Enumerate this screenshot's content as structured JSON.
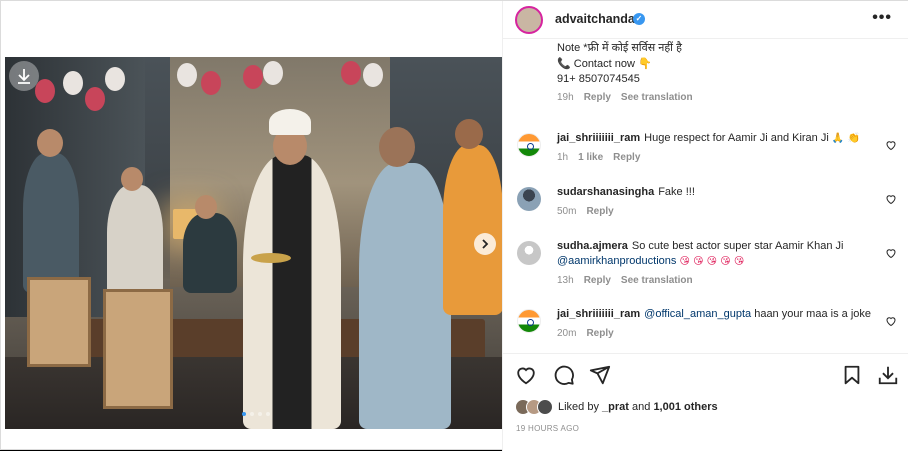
{
  "post": {
    "username": "advaitchandan",
    "more_label": "•••",
    "verified_mark": "✓"
  },
  "caption": {
    "line1": "Note *फ्री में कोई सर्विस नहीं है",
    "line2": "📞 Contact now 👇",
    "line3": "91+ 8507074545",
    "time": "19h",
    "reply": "Reply",
    "translate": "See translation"
  },
  "comments": [
    {
      "user": "jai_shriiiiiii_ram",
      "text": "Huge respect for Aamir Ji and Kiran Ji",
      "emoji": "🙏 👏",
      "time": "1h",
      "likes": "1 like",
      "reply": "Reply",
      "avatar": "india-flag"
    },
    {
      "user": "sudarshanasingha",
      "text": "Fake !!!",
      "time": "50m",
      "reply": "Reply",
      "avatar": "person-photo"
    },
    {
      "user": "sudha.ajmera",
      "text": "So cute best actor super star Aamir Khan Ji",
      "mention": "@aamirkhanproductions",
      "emoji": "😘 😘 😘 😘 😘",
      "time": "13h",
      "reply": "Reply",
      "translate": "See translation",
      "avatar": "default-avatar"
    },
    {
      "user": "jai_shriiiiiii_ram",
      "mention": "@offical_aman_gupta",
      "text": "haan your maa is a joke",
      "time": "20m",
      "reply": "Reply",
      "avatar": "india-flag"
    }
  ],
  "likes": {
    "prefix": "Liked by",
    "user": "_prat",
    "middle": "and",
    "others": "1,001 others"
  },
  "timestamp": "19 HOURS AGO",
  "icons": {
    "like": "heart-icon",
    "comment": "comment-icon",
    "share": "send-icon",
    "save": "bookmark-icon",
    "download": "download-icon",
    "next": "chevron-right-icon"
  },
  "colors": {
    "link": "#00376b",
    "verified": "#3897f0",
    "muted": "#8e8e8e"
  },
  "carousel": {
    "current": 1,
    "total": 4
  }
}
